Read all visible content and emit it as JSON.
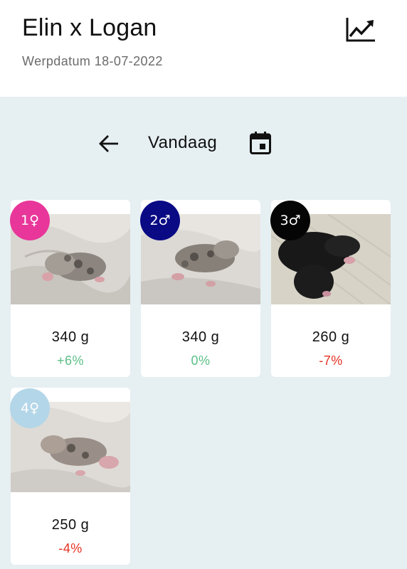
{
  "header": {
    "title": "Elin x Logan",
    "subtitle": "Werpdatum 18-07-2022",
    "chart_icon": "chart-line-icon"
  },
  "datebar": {
    "back_icon": "arrow-left-icon",
    "label": "Vandaag",
    "calendar_icon": "calendar-icon"
  },
  "puppies": [
    {
      "badge": "1♀",
      "badge_color": "#e8369a",
      "weight": "340 g",
      "delta": "+6%",
      "delta_kind": "pos"
    },
    {
      "badge": "2♂",
      "badge_color": "#0a0a85",
      "weight": "340 g",
      "delta": "0%",
      "delta_kind": "zero"
    },
    {
      "badge": "3♂",
      "badge_color": "#050505",
      "weight": "260 g",
      "delta": "-7%",
      "delta_kind": "neg"
    },
    {
      "badge": "4♀",
      "badge_color": "#b3d6e8",
      "weight": "250 g",
      "delta": "-4%",
      "delta_kind": "neg"
    }
  ],
  "colors": {
    "background": "#e6eff2",
    "positive": "#5cbf86",
    "negative": "#e53224"
  }
}
